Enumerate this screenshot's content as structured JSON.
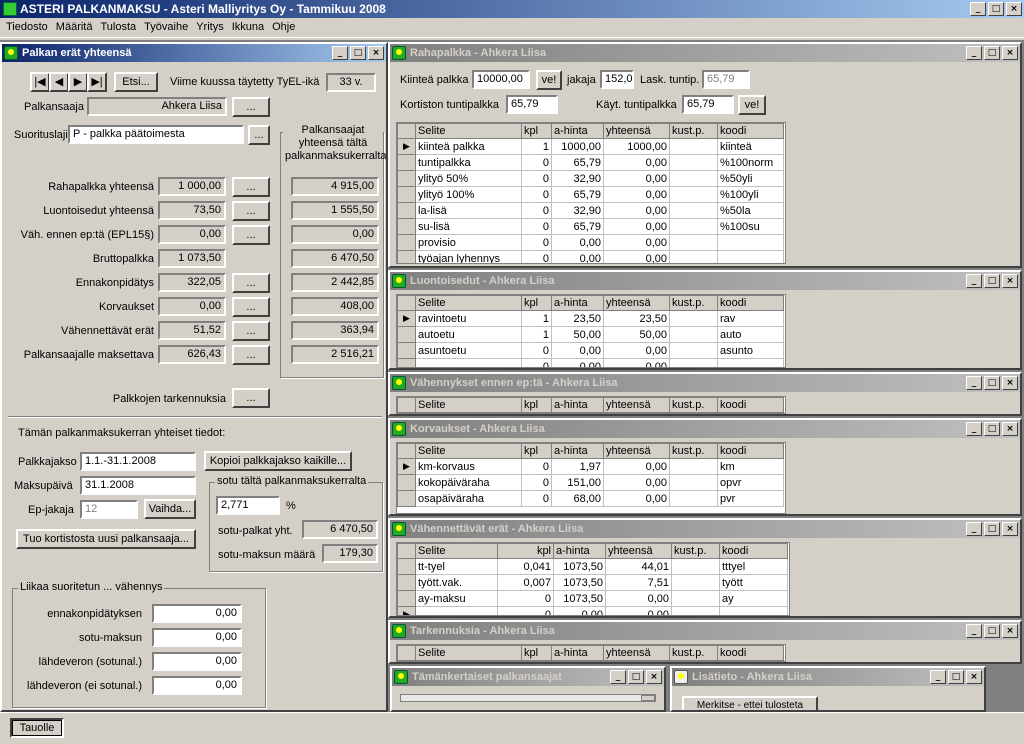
{
  "app": {
    "title": "ASTERI PALKANMAKSU - Asteri Malliyritys Oy - Tammikuu 2008",
    "min": "_",
    "max": "□",
    "close": "×"
  },
  "menu": [
    "Tiedosto",
    "Määritä",
    "Tulosta",
    "Työvaihe",
    "Yritys",
    "Ikkuna",
    "Ohje"
  ],
  "main": {
    "title": "Palkan erät yhteensä",
    "nav": [
      "|◀",
      "◀",
      "▶",
      "▶|"
    ],
    "etsi": "Etsi...",
    "tyel_label": "Viime kuussa täytetty TyEL-ikä",
    "tyel_value": "33 v.",
    "palkansaaja_label": "Palkansaaja",
    "palkansaaja_value": "Ahkera Liisa",
    "dots": "...",
    "suorituslaji_label": "Suorituslaji",
    "suorituslaji_value": "P    - palkka päätoimesta",
    "totals_group": "Palkansaajat yhteensä tältä palkanmaksukerralta",
    "rows": [
      {
        "label": "Rahapalkka yhteensä",
        "value": "1 000,00",
        "total": "4 915,00",
        "btn": true
      },
      {
        "label": "Luontoisedut yhteensä",
        "value": "73,50",
        "total": "1 555,50",
        "btn": true
      },
      {
        "label": "Väh. ennen ep:tä (EPL15§)",
        "value": "0,00",
        "total": "0,00",
        "btn": true
      },
      {
        "label": "Bruttopalkka",
        "value": "1 073,50",
        "total": "6 470,50",
        "btn": false
      },
      {
        "label": "Ennakonpidätys",
        "value": "322,05",
        "total": "2 442,85",
        "btn": true
      },
      {
        "label": "Korvaukset",
        "value": "0,00",
        "total": "408,00",
        "btn": true
      },
      {
        "label": "Vähennettävät erät",
        "value": "51,52",
        "total": "363,94",
        "btn": true
      },
      {
        "label": "Palkansaajalle maksettava",
        "value": "626,43",
        "total": "2 516,21",
        "btn": true
      }
    ],
    "tarkennuksia_label": "Palkkojen tarkennuksia",
    "yhteiset_label": "Tämän palkanmaksukerran yhteiset tiedot:",
    "palkkajakso_label": "Palkkajakso",
    "palkkajakso_value": "1.1.-31.1.2008",
    "kopioi": "Kopioi palkkajakso kaikille...",
    "maksupaiva_label": "Maksupäivä",
    "maksupaiva_value": "31.1.2008",
    "epjakaja_label": "Ep-jakaja",
    "epjakaja_value": "12",
    "vaihda": "Vaihda...",
    "tuo": "Tuo kortistosta uusi palkansaaja...",
    "sotu_group": "sotu tältä palkanmaksukerralta",
    "sotu_pct": "2,771",
    "pct": "%",
    "sotu_palkat_label": "sotu-palkat yht.",
    "sotu_palkat_value": "6 470,50",
    "sotu_maara_label": "sotu-maksun määrä",
    "sotu_maara_value": "179,30",
    "liikaa_group": "Liikaa suoritetun ... vähennys",
    "liikaa": [
      {
        "label": "ennakonpidätyksen",
        "value": "0,00"
      },
      {
        "label": "sotu-maksun",
        "value": "0,00"
      },
      {
        "label": "lähdeveron (sotunal.)",
        "value": "0,00"
      },
      {
        "label": "lähdeveron (ei sotunal.)",
        "value": "0,00"
      }
    ]
  },
  "raha": {
    "title": "Rahapalkka - Ahkera Liisa",
    "kiintea_label": "Kiinteä palkka",
    "kiintea_value": "10000,00",
    "ve": "ve!",
    "jakaja_label": "jakaja",
    "jakaja_value": "152,0",
    "lask_label": "Lask. tuntip.",
    "lask_value": "65,79",
    "kort_label": "Kortiston tuntipalkka",
    "kort_value": "65,79",
    "kayt_label": "Käyt. tuntipalkka",
    "kayt_value": "65,79",
    "cols": [
      "Selite",
      "kpl",
      "a-hinta",
      "yhteensä",
      "kust.p.",
      "koodi"
    ],
    "rows": [
      [
        "kiinteä palkka",
        "1",
        "1000,00",
        "1000,00",
        "",
        "kiinteä"
      ],
      [
        "tuntipalkka",
        "0",
        "65,79",
        "0,00",
        "",
        "%100norm"
      ],
      [
        "ylityö 50%",
        "0",
        "32,90",
        "0,00",
        "",
        "%50yli"
      ],
      [
        "ylityö 100%",
        "0",
        "65,79",
        "0,00",
        "",
        "%100yli"
      ],
      [
        "la-lisä",
        "0",
        "32,90",
        "0,00",
        "",
        "%50la"
      ],
      [
        "su-lisä",
        "0",
        "65,79",
        "0,00",
        "",
        "%100su"
      ],
      [
        "provisio",
        "0",
        "0,00",
        "0,00",
        "",
        ""
      ],
      [
        "työajan lyhennys",
        "0",
        "0,00",
        "0,00",
        "",
        ""
      ]
    ]
  },
  "luonto": {
    "title": "Luontoisedut - Ahkera Liisa",
    "cols": [
      "Selite",
      "kpl",
      "a-hinta",
      "yhteensä",
      "kust.p.",
      "koodi"
    ],
    "rows": [
      [
        "ravintoetu",
        "1",
        "23,50",
        "23,50",
        "",
        "rav"
      ],
      [
        "autoetu",
        "1",
        "50,00",
        "50,00",
        "",
        "auto"
      ],
      [
        "asuntoetu",
        "0",
        "0,00",
        "0,00",
        "",
        "asunto"
      ],
      [
        "",
        "0",
        "0,00",
        "0,00",
        "",
        ""
      ]
    ]
  },
  "vahennykset": {
    "title": "Vähennykset ennen ep:tä - Ahkera Liisa",
    "cols": [
      "Selite",
      "kpl",
      "a-hinta",
      "yhteensä",
      "kust.p.",
      "koodi"
    ]
  },
  "korvaukset": {
    "title": "Korvaukset - Ahkera Liisa",
    "cols": [
      "Selite",
      "kpl",
      "a-hinta",
      "yhteensä",
      "kust.p.",
      "koodi"
    ],
    "rows": [
      [
        "km-korvaus",
        "0",
        "1,97",
        "0,00",
        "",
        "km"
      ],
      [
        "kokopäiväraha",
        "0",
        "151,00",
        "0,00",
        "",
        "opvr"
      ],
      [
        "osapäiväraha",
        "0",
        "68,00",
        "0,00",
        "",
        "pvr"
      ]
    ]
  },
  "vahennettavat": {
    "title": "Vähennettävät erät - Ahkera Liisa",
    "cols": [
      "Selite",
      "kpl",
      "a-hinta",
      "yhteensä",
      "kust.p.",
      "koodi"
    ],
    "rows": [
      [
        "tt-tyel",
        "0,041",
        "1073,50",
        "44,01",
        "",
        "tttyel"
      ],
      [
        "tyött.vak.",
        "0,007",
        "1073,50",
        "7,51",
        "",
        "tyött"
      ],
      [
        "ay-maksu",
        "0",
        "1073,50",
        "0,00",
        "",
        "ay"
      ],
      [
        "",
        "0",
        "0,00",
        "0,00",
        "",
        ""
      ]
    ]
  },
  "tarkennuksia": {
    "title": "Tarkennuksia - Ahkera Liisa",
    "cols": [
      "Selite",
      "kpl",
      "a-hinta",
      "yhteensä",
      "kust.p.",
      "koodi"
    ]
  },
  "tamankertaiset": {
    "title": "Tämänkertaiset palkansaajat"
  },
  "lisatieto": {
    "title": "Lisätieto - Ahkera Liisa",
    "btn": "Merkitse - ettei tulosteta"
  },
  "taskbar": {
    "tauolle": "Tauolle"
  }
}
